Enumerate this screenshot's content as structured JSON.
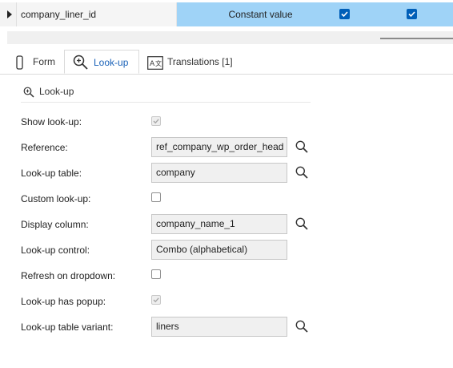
{
  "grid": {
    "row": {
      "name": "company_liner_id",
      "value": "Constant value",
      "check1": true,
      "check2": true
    }
  },
  "tabs": [
    {
      "label": "Form",
      "icon": "form-icon",
      "active": false
    },
    {
      "label": "Look-up",
      "icon": "lookup-zoom-icon",
      "active": true
    },
    {
      "label": "Translations [1]",
      "icon": "translate-icon",
      "active": false
    }
  ],
  "section": {
    "title": "Look-up",
    "icon": "magnifier-icon"
  },
  "fields": {
    "show_lookup": {
      "label": "Show look-up:",
      "checked": true,
      "disabled": true
    },
    "reference": {
      "label": "Reference:",
      "value": "ref_company_wp_order_head"
    },
    "lookup_table": {
      "label": "Look-up table:",
      "value": "company"
    },
    "custom_lookup": {
      "label": "Custom look-up:",
      "checked": false
    },
    "display_column": {
      "label": "Display column:",
      "value": "company_name_1"
    },
    "lookup_control": {
      "label": "Look-up control:",
      "value": "Combo (alphabetical)"
    },
    "refresh_on_dropdown": {
      "label": "Refresh on dropdown:",
      "checked": false
    },
    "lookup_has_popup": {
      "label": "Look-up has popup:",
      "checked": true,
      "disabled": true
    },
    "lookup_table_variant": {
      "label": "Look-up table variant:",
      "value": "liners"
    }
  },
  "colors": {
    "selection": "#9fd3f7",
    "accent": "#1a62b8",
    "checkbox_blue": "#005fb8"
  }
}
